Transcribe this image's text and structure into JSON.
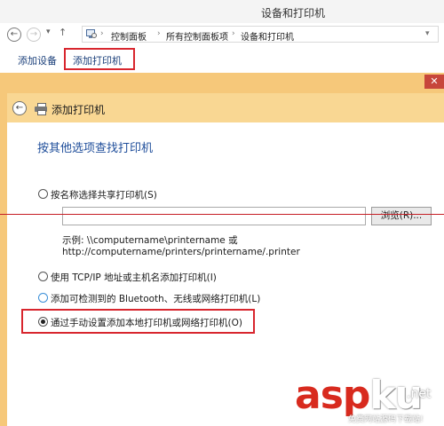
{
  "window": {
    "title": "设备和打印机",
    "close_glyph": "✕"
  },
  "address_bar": {
    "back_glyph": "←",
    "forward_glyph": "→",
    "dropdown_glyph": "▾",
    "up_glyph": "↑",
    "breadcrumbs": [
      "控制面板",
      "所有控制面板项",
      "设备和打印机"
    ],
    "separator": "›",
    "icon": "control-panel-icon"
  },
  "toolbar": {
    "add_device": "添加设备",
    "add_printer": "添加打印机"
  },
  "wizard": {
    "title": "添加打印机",
    "back_glyph": "←",
    "heading": "按其他选项查找打印机",
    "options": [
      {
        "label": "按名称选择共享打印机(S)",
        "checked": false
      },
      {
        "label": "使用 TCP/IP 地址或主机名添加打印机(I)",
        "checked": false
      },
      {
        "label": "添加可检测到的 Bluetooth、无线或网络打印机(L)",
        "checked": false
      },
      {
        "label": "通过手动设置添加本地打印机或网络打印机(O)",
        "checked": true
      }
    ],
    "shared_input_value": "",
    "browse_label": "浏览(R)...",
    "example_line1": "示例: \\\\computername\\printername 或",
    "example_line2": "http://computername/printers/printername/.printer"
  },
  "watermark": {
    "main_a": "asp",
    "main_b": "ku",
    "suffix": ".net",
    "sub": "免费网站源码下载站!"
  },
  "colors": {
    "accent_frame": "#f6c87a",
    "highlight_red": "#d8262e",
    "heading_blue": "#1e4d9a",
    "toolbar_link": "#1a3f7a"
  }
}
